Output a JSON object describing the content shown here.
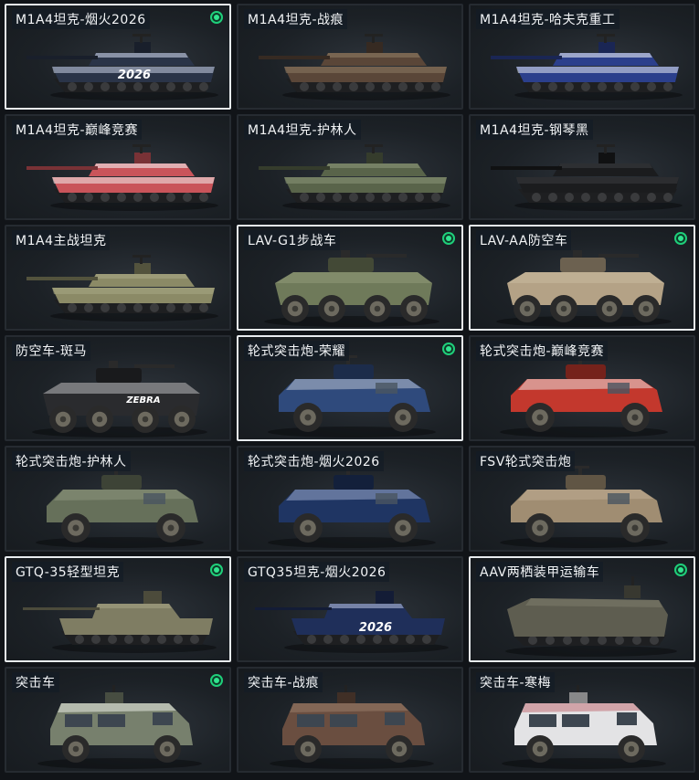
{
  "vehicles": [
    {
      "name": "M1A4坦克-烟火2026",
      "selected": true,
      "owned": true,
      "kind": "tank",
      "body": "#2a3448",
      "accent": "#c9d2e6",
      "decal": "2026"
    },
    {
      "name": "M1A4坦克-战痕",
      "selected": false,
      "owned": false,
      "kind": "tank",
      "body": "#5a4638",
      "accent": "#8c7a62"
    },
    {
      "name": "M1A4坦克-哈夫克重工",
      "selected": false,
      "owned": false,
      "kind": "tank",
      "body": "#2b3f8c",
      "accent": "#e7ebf3"
    },
    {
      "name": "M1A4坦克-巅峰竞赛",
      "selected": false,
      "owned": false,
      "kind": "tank",
      "body": "#c9545a",
      "accent": "#f1eded"
    },
    {
      "name": "M1A4坦克-护林人",
      "selected": false,
      "owned": false,
      "kind": "tank",
      "body": "#59644a",
      "accent": "#8b9578"
    },
    {
      "name": "M1A4坦克-钢琴黑",
      "selected": false,
      "owned": false,
      "kind": "tank",
      "body": "#1b1c1e",
      "accent": "#3a3c40"
    },
    {
      "name": "M1A4主战坦克",
      "selected": false,
      "owned": false,
      "kind": "tank",
      "body": "#8b8a66",
      "accent": "#a8a783"
    },
    {
      "name": "LAV-G1步战车",
      "selected": true,
      "owned": true,
      "kind": "apc",
      "body": "#6f7a5a",
      "accent": "#96a07f"
    },
    {
      "name": "LAV-AA防空车",
      "selected": true,
      "owned": true,
      "kind": "apc",
      "body": "#b4a286",
      "accent": "#cdbea4"
    },
    {
      "name": "防空车-斑马",
      "selected": false,
      "owned": false,
      "kind": "apc",
      "body": "#2a2b2e",
      "accent": "#d8d9dc",
      "decal": "ZEBRA"
    },
    {
      "name": "轮式突击炮-荣耀",
      "selected": true,
      "owned": true,
      "kind": "armored-car",
      "body": "#2f4a7c",
      "accent": "#c7ced9"
    },
    {
      "name": "轮式突击炮-巅峰竞赛",
      "selected": false,
      "owned": false,
      "kind": "armored-car",
      "body": "#c3382d",
      "accent": "#eeeeee"
    },
    {
      "name": "轮式突击炮-护林人",
      "selected": false,
      "owned": false,
      "kind": "armored-car",
      "body": "#66705a",
      "accent": "#8f9880"
    },
    {
      "name": "轮式突击炮-烟火2026",
      "selected": false,
      "owned": false,
      "kind": "armored-car",
      "body": "#1f3563",
      "accent": "#a6b4d6"
    },
    {
      "name": "FSV轮式突击炮",
      "selected": false,
      "owned": false,
      "kind": "armored-car",
      "body": "#a08d72",
      "accent": "#c2b095"
    },
    {
      "name": "GTQ-35轻型坦克",
      "selected": true,
      "owned": true,
      "kind": "light-tank",
      "body": "#7f7d63",
      "accent": "#a3a184"
    },
    {
      "name": "GTQ35坦克-烟火2026",
      "selected": false,
      "owned": false,
      "kind": "light-tank",
      "body": "#1f2f5a",
      "accent": "#b0bcda",
      "decal": "2026"
    },
    {
      "name": "AAV两栖装甲运输车",
      "selected": true,
      "owned": true,
      "kind": "amphibious",
      "body": "#5e5d50",
      "accent": "#7d7c6c"
    },
    {
      "name": "突击车",
      "selected": false,
      "owned": true,
      "kind": "assault-car",
      "body": "#77806d",
      "accent": "#dfe2da"
    },
    {
      "name": "突击车-战痕",
      "selected": false,
      "owned": false,
      "kind": "assault-car",
      "body": "#6a4e40",
      "accent": "#947866"
    },
    {
      "name": "突击车-寒梅",
      "selected": false,
      "owned": false,
      "kind": "assault-car",
      "body": "#e3e3e5",
      "accent": "#c47a80"
    }
  ]
}
